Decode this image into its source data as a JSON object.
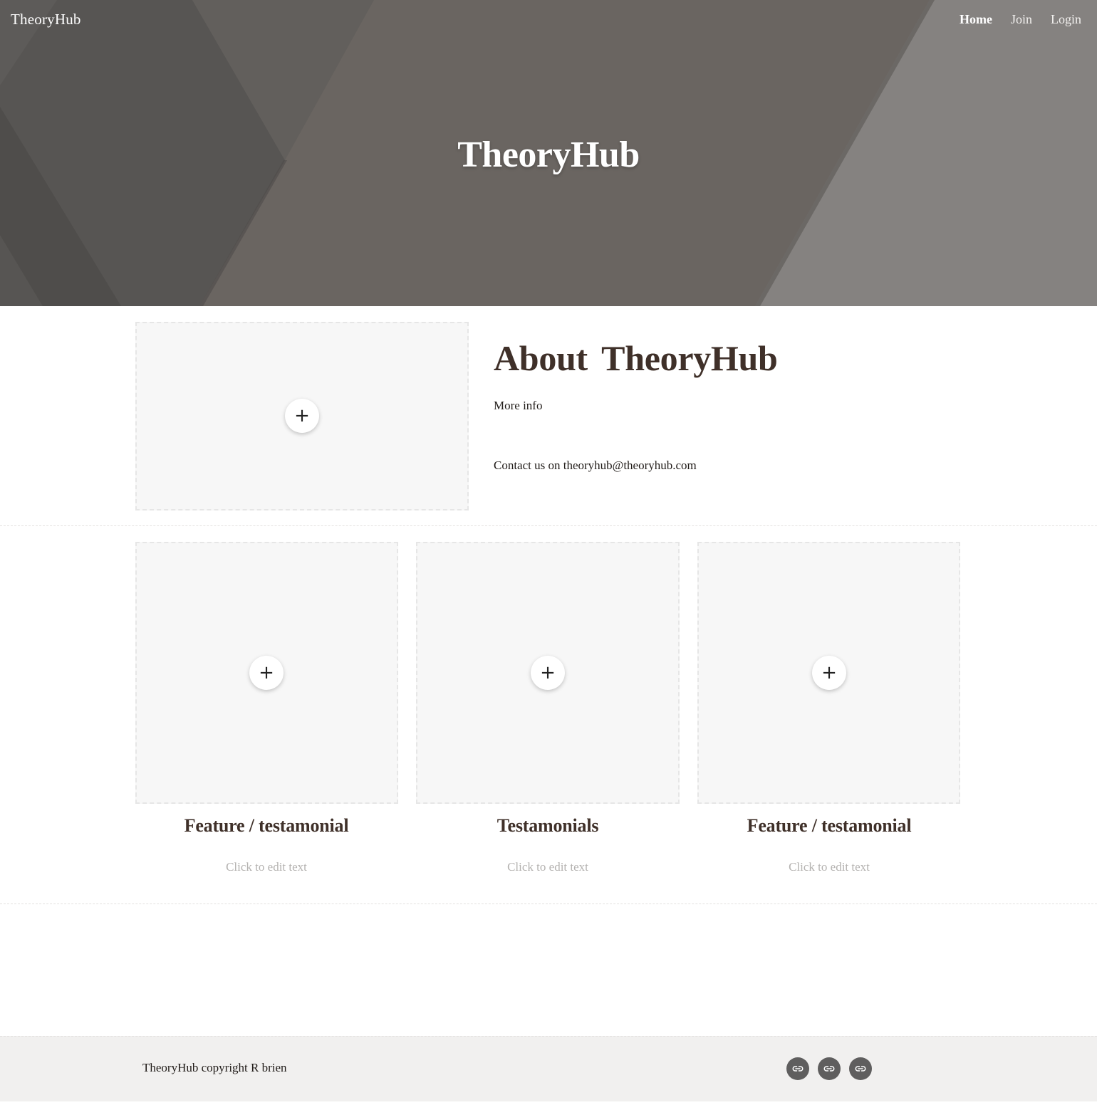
{
  "header": {
    "site_name": "TheoryHub",
    "nav": [
      "Home",
      "Join",
      "Login"
    ]
  },
  "hero": {
    "title": "TheoryHub"
  },
  "about": {
    "title": "About  TheoryHub",
    "more_info": "More info",
    "contact": "Contact us on theoryhub@theoryhub.com",
    "add_icon": "plus-icon"
  },
  "features": [
    {
      "title": "Feature / testamonial",
      "text": "Click to edit text"
    },
    {
      "title": "Testamonials",
      "text": "Click to edit text"
    },
    {
      "title": "Feature / testamonial",
      "text": "Click to edit text"
    }
  ],
  "footer": {
    "copyright": "TheoryHub copyright R brien",
    "social_icons": [
      "link-icon",
      "link-icon",
      "link-icon"
    ]
  },
  "colors": {
    "heading": "#3f3029",
    "placeholder_bg": "#f7f7f7",
    "footer_bg": "#f1f0ef",
    "social_bg": "#5f5e5e"
  }
}
